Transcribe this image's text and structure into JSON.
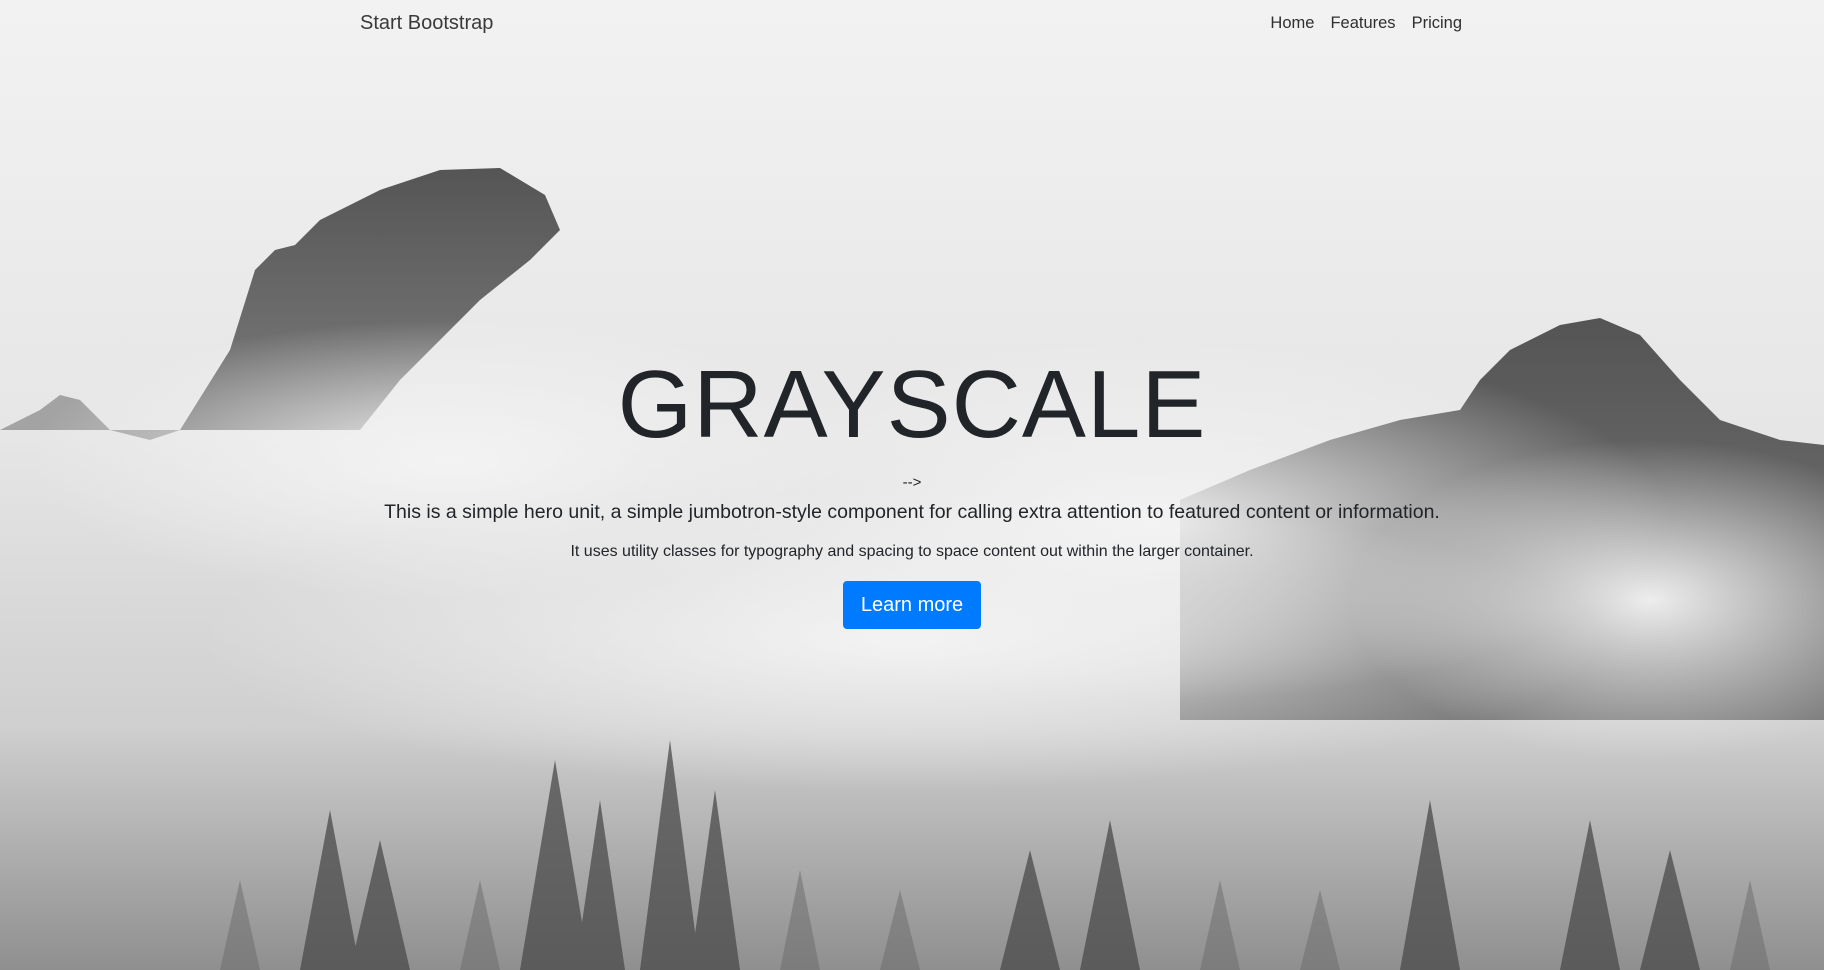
{
  "navbar": {
    "brand": "Start Bootstrap",
    "links": [
      "Home",
      "Features",
      "Pricing"
    ]
  },
  "hero": {
    "title": "GRAYSCALE",
    "arrow": "-->",
    "lead": "This is a simple hero unit, a simple jumbotron-style component for calling extra attention to featured content or information.",
    "sub": "It uses utility classes for typography and spacing to space content out within the larger container.",
    "button_label": "Learn more"
  },
  "colors": {
    "button": "#007bff",
    "text": "#212529"
  },
  "background": {
    "icon": "misty-mountains-forest-photo"
  }
}
